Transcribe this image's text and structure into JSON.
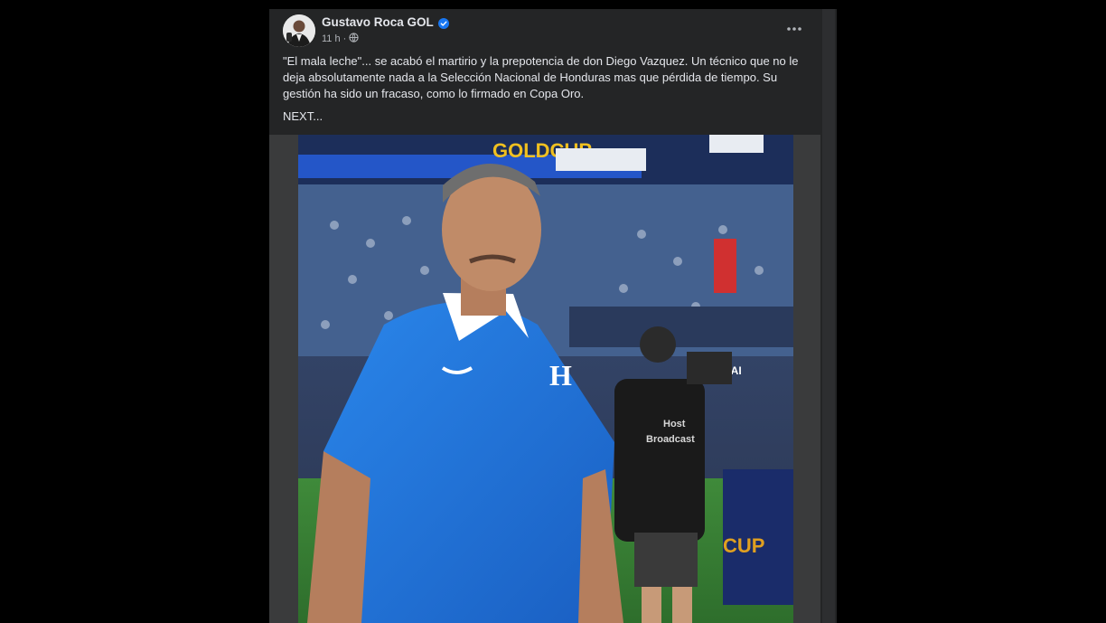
{
  "post": {
    "author": "Gustavo Roca GOL",
    "time": "11 h",
    "separator": "·",
    "text": "\"El mala leche\"... se acabó el martirio y la prepotencia de don Diego Vazquez. Un técnico que no le deja absolutamente nada a la Selección Nacional de Honduras mas que pérdida de tiempo. Su gestión ha sido un fracaso, como lo firmado en Copa Oro.",
    "next": "NEXT...",
    "privacy_icon": "globe-icon",
    "verified_icon": "verified-badge-icon",
    "more_icon": "more-options-icon"
  },
  "photo": {
    "stadium_banner": "GOLDCUP",
    "shirt_crest": "H",
    "camera_vest_line1": "Host",
    "camera_vest_line2": "Broadcast",
    "corner_sign": "CUP",
    "side_sign": "HAI"
  },
  "colors": {
    "background": "#000000",
    "card": "#242526",
    "text": "#e4e6eb",
    "muted": "#b0b3b8",
    "verified": "#1877f2",
    "jersey": "#1f6fd6"
  }
}
